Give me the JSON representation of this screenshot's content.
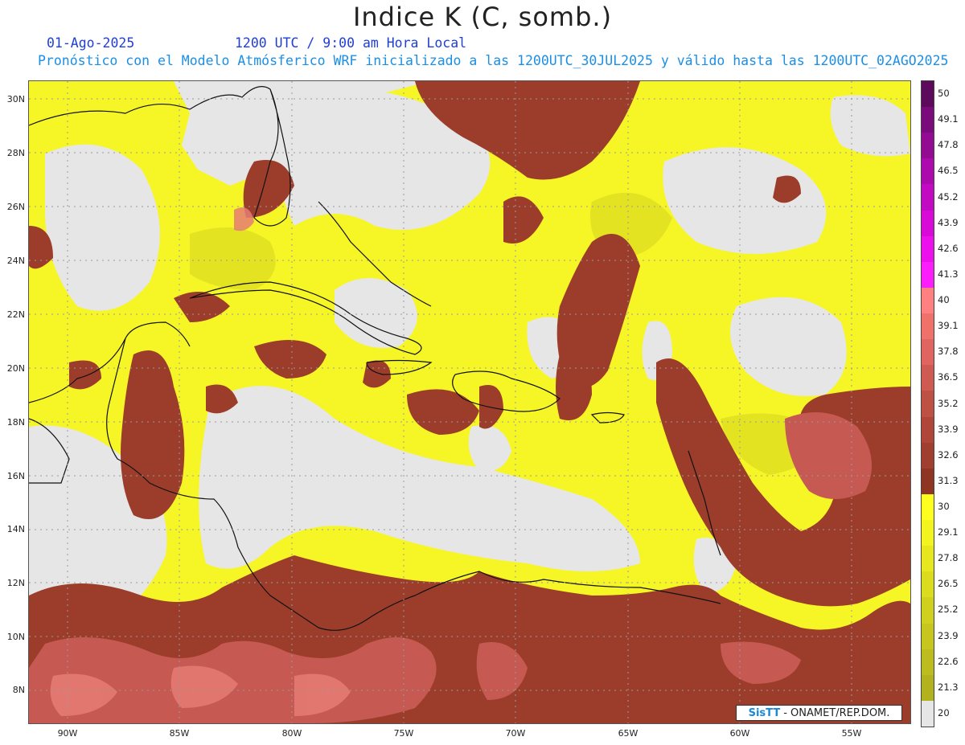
{
  "header": {
    "title": "Indice K (C, somb.)",
    "date": "01-Ago-2025",
    "time": "1200 UTC / 9:00 am Hora Local",
    "forecast": "Pronóstico con el Modelo Atmósferico WRF inicializado a las 1200UTC_30JUL2025 y válido hasta las  1200UTC_02AGO2025"
  },
  "map": {
    "lat_labels": [
      "30N",
      "28N",
      "26N",
      "24N",
      "22N",
      "20N",
      "18N",
      "16N",
      "14N",
      "12N",
      "10N",
      "8N"
    ],
    "lon_labels": [
      "90W",
      "85W",
      "80W",
      "75W",
      "70W",
      "65W",
      "60W",
      "55W"
    ],
    "lat_range": [
      7,
      30.5
    ],
    "lon_range": [
      -91.9,
      -52.6
    ],
    "colors": {
      "ocean_background": "#e6e6e6",
      "kindex_25_30": "#f6f626",
      "kindex_20_25": "#e0e024",
      "kindex_30_33": "#9c3d2c",
      "kindex_33_36": "#b34e3f",
      "kindex_36_40": "#d26a64",
      "coastline": "#111111"
    }
  },
  "colorbar": {
    "labels": [
      "50",
      "49.1",
      "47.8",
      "46.5",
      "45.2",
      "43.9",
      "42.6",
      "41.3",
      "40",
      "39.1",
      "37.8",
      "36.5",
      "35.2",
      "33.9",
      "32.6",
      "31.3",
      "30",
      "29.1",
      "27.8",
      "26.5",
      "25.2",
      "23.9",
      "22.6",
      "21.3",
      "20"
    ],
    "colors": [
      "#5e0a5c",
      "#7b0a7b",
      "#930a93",
      "#ad0aad",
      "#c20ac2",
      "#d80ad8",
      "#ec10ec",
      "#fb1efb",
      "#ff8080",
      "#f0706a",
      "#e06460",
      "#cf5a52",
      "#bf5044",
      "#b04639",
      "#a03e2f",
      "#8f3524",
      "#ffff1f",
      "#f3f31f",
      "#e7e71f",
      "#dcdc1f",
      "#d0d01f",
      "#c6c61f",
      "#bcbc1f",
      "#b2b21f",
      "#e6e6e6"
    ]
  },
  "credit": {
    "brand": "SisTT",
    "text": "- ONAMET/REP.DOM."
  }
}
